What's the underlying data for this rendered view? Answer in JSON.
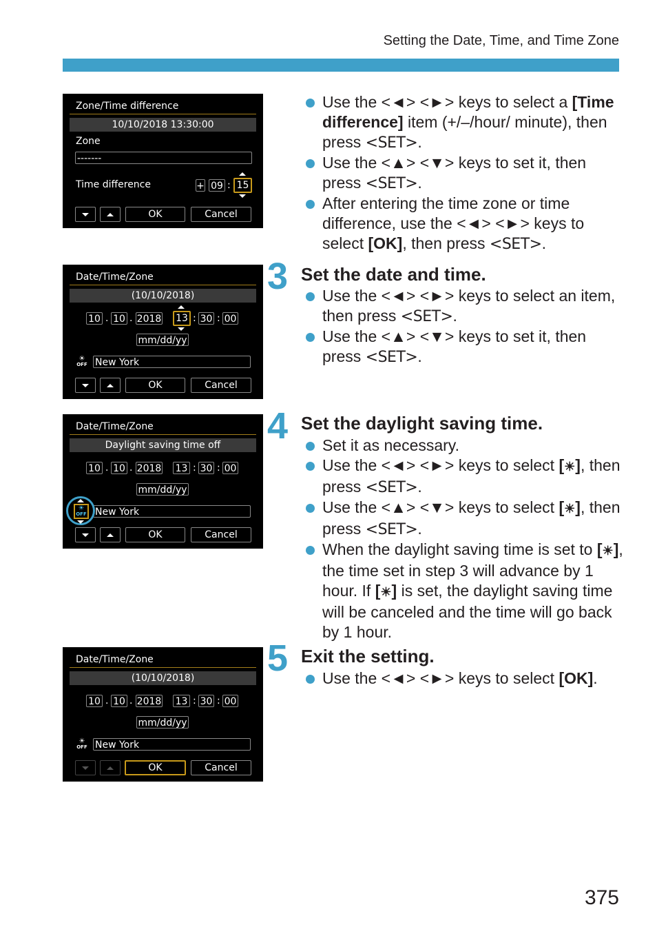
{
  "header": {
    "running_title": "Setting the Date, Time, and Time Zone",
    "bar_color": "#3fa0c9"
  },
  "page_number": "375",
  "screens": {
    "zone_time": {
      "title": "Zone/Time difference",
      "datetime": "10/10/2018 13:30:00",
      "zone_label": "Zone",
      "zone_value": "-------",
      "time_diff_label": "Time difference",
      "sign": "+",
      "hour": "09",
      "minute": "15",
      "ok": "OK",
      "cancel": "Cancel"
    },
    "date_time_1": {
      "title": "Date/Time/Zone",
      "band": "(10/10/2018)",
      "month": "10",
      "day": "10",
      "year": "2018",
      "hour": "13",
      "minute": "30",
      "second": "00",
      "format": "mm/dd/yy",
      "dst_icon_label": "OFF",
      "zone": "New York",
      "ok": "OK",
      "cancel": "Cancel"
    },
    "date_time_2": {
      "title": "Date/Time/Zone",
      "band": "Daylight saving time off",
      "month": "10",
      "day": "10",
      "year": "2018",
      "hour": "13",
      "minute": "30",
      "second": "00",
      "format": "mm/dd/yy",
      "dst_icon_label": "OFF",
      "zone": "New York",
      "ok": "OK",
      "cancel": "Cancel"
    },
    "date_time_3": {
      "title": "Date/Time/Zone",
      "band": "(10/10/2018)",
      "month": "10",
      "day": "10",
      "year": "2018",
      "hour": "13",
      "minute": "30",
      "second": "00",
      "format": "mm/dd/yy",
      "dst_icon_label": "OFF",
      "zone": "New York",
      "ok": "OK",
      "cancel": "Cancel"
    }
  },
  "keys": {
    "left": "<◄>",
    "right": "<►>",
    "up": "<▲>",
    "down": "<▼>",
    "set": "<SET>",
    "sun": "☀",
    "sun_off_label": "OFF"
  },
  "intro_bullets": {
    "b1": {
      "pre": "Use the ",
      "mid1": " ",
      "post1": " keys to select a ",
      "bold": "[Time difference]",
      "post2": " item (+/–/hour/ minute), then press ",
      "end": "."
    },
    "b2": {
      "pre": "Use the ",
      "mid1": " ",
      "post1": " keys to set it, then press ",
      "end": "."
    },
    "b3": {
      "pre": "After entering the time zone or time difference, use the ",
      "mid1": " ",
      "post1": " keys to select ",
      "bold": "[OK]",
      "post2": ", then press ",
      "end": "."
    }
  },
  "steps": [
    {
      "number": "3",
      "title": "Set the date and time.",
      "b1": {
        "pre": "Use the ",
        "mid1": " ",
        "post1": " keys to select an item, then press ",
        "end": "."
      },
      "b2": {
        "pre": "Use the ",
        "mid1": " ",
        "post1": " keys to set it, then press ",
        "end": "."
      }
    },
    {
      "number": "4",
      "title": "Set the daylight saving time.",
      "b1": {
        "text": "Set it as necessary."
      },
      "b2": {
        "pre": "Use the ",
        "mid1": " ",
        "post1": " keys to select ",
        "post2": ", then press ",
        "end": "."
      },
      "b3": {
        "pre": "Use the ",
        "mid1": " ",
        "post1": " keys to select ",
        "post2": ", then press ",
        "end": "."
      },
      "b4": {
        "pre": "When the daylight saving time is set to ",
        "post1": ", the time set in step 3 will advance by 1 hour. If ",
        "post2": " is set, the daylight saving time will be canceled and the time will go back by 1 hour."
      }
    },
    {
      "number": "5",
      "title": "Exit the setting.",
      "b1": {
        "pre": "Use the ",
        "mid1": " ",
        "post1": " keys to select ",
        "bold": "[OK]",
        "end": "."
      }
    }
  ]
}
